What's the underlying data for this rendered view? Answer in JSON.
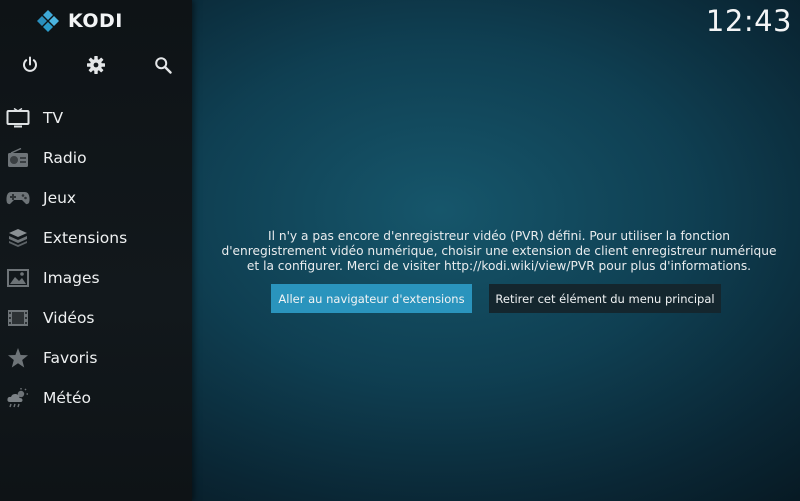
{
  "app": {
    "logo_text": "KODI",
    "clock": "12:43"
  },
  "top_icons": [
    {
      "name": "power-icon"
    },
    {
      "name": "gear-icon"
    },
    {
      "name": "search-icon"
    }
  ],
  "menu": {
    "items": [
      {
        "label": "TV",
        "icon": "tv-icon"
      },
      {
        "label": "Radio",
        "icon": "radio-icon"
      },
      {
        "label": "Jeux",
        "icon": "gamepad-icon"
      },
      {
        "label": "Extensions",
        "icon": "box-icon"
      },
      {
        "label": "Images",
        "icon": "image-icon"
      },
      {
        "label": "Vidéos",
        "icon": "film-icon"
      },
      {
        "label": "Favoris",
        "icon": "star-icon"
      },
      {
        "label": "Météo",
        "icon": "weather-icon"
      }
    ]
  },
  "main": {
    "message_lines": [
      "Il n'y a pas encore d'enregistreur vidéo (PVR) défini. Pour utiliser la fonction",
      "d'enregistrement vidéo numérique, choisir une extension de client enregistreur numérique",
      "et la configurer. Merci de visiter http://kodi.wiki/view/PVR pour plus d'informations."
    ],
    "primary_button": "Aller au navigateur d'extensions",
    "secondary_button": "Retirer cet élément du menu principal"
  },
  "colors": {
    "accent": "#2a94bd",
    "background": "#0f3f52",
    "sidebar": "#12181c"
  }
}
